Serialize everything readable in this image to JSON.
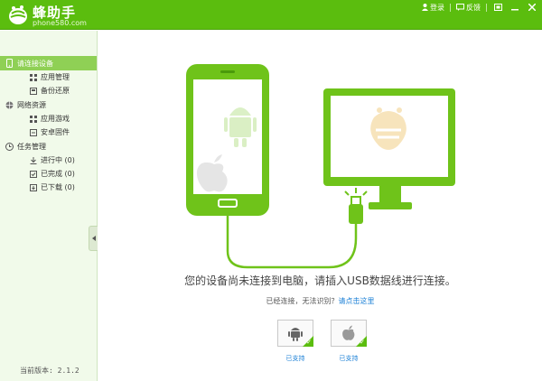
{
  "app": {
    "brand": "蜂助手",
    "domain": "phone580.com"
  },
  "topbar": {
    "login": "登录",
    "feedback": "反馈"
  },
  "sidebar": {
    "groups": [
      {
        "label": "请连接设备",
        "icon": "phone-icon",
        "items": [
          {
            "label": "应用管理",
            "icon": "grid-icon"
          },
          {
            "label": "备份还原",
            "icon": "backup-icon"
          }
        ]
      },
      {
        "label": "网络资源",
        "icon": "globe-icon",
        "items": [
          {
            "label": "应用游戏",
            "icon": "apps-icon"
          },
          {
            "label": "安卓固件",
            "icon": "firmware-icon"
          }
        ]
      },
      {
        "label": "任务管理",
        "icon": "task-icon",
        "items": [
          {
            "label": "进行中 (0)",
            "icon": "download-icon"
          },
          {
            "label": "已完成 (0)",
            "icon": "done-icon"
          },
          {
            "label": "已下载 (0)",
            "icon": "downloaded-icon"
          }
        ]
      }
    ],
    "version": "当前版本: 2.1.2"
  },
  "main": {
    "message": "您的设备尚未连接到电脑，请插入USB数据线进行连接。",
    "sub_prefix": "已经连接，无法识别？",
    "sub_link": "请点击这里",
    "android_label": "已支持",
    "ios_label": "已支持"
  },
  "colors": {
    "accent": "#5bbd0e",
    "link": "#1a7fd6"
  }
}
